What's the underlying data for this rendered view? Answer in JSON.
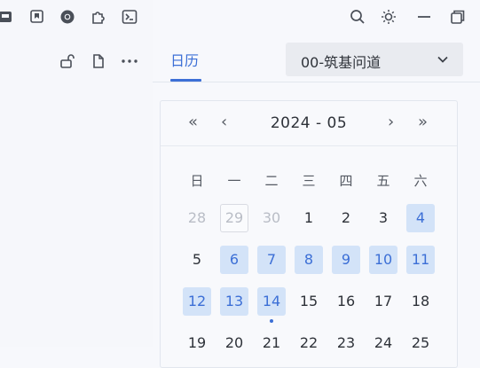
{
  "left_toolbar": {
    "icons": [
      "inbox-icon",
      "bookmark-icon",
      "chrome-icon",
      "puzzle-icon",
      "terminal-icon"
    ],
    "row2_icons": [
      "unlock-icon",
      "file-icon",
      "more-icon"
    ]
  },
  "window_controls": [
    "search-icon",
    "theme-icon",
    "minimize-icon",
    "restore-icon"
  ],
  "panel": {
    "tab_label": "日历",
    "select_value": "00-筑基问道"
  },
  "calendar": {
    "month_label": "2024 - 05",
    "nav": {
      "prev_year": "«",
      "prev_month": "‹",
      "next_month": "›",
      "next_year": "»"
    },
    "weekdays": [
      "日",
      "一",
      "二",
      "三",
      "四",
      "五",
      "六"
    ],
    "weeks": [
      [
        {
          "d": "28",
          "other": true
        },
        {
          "d": "29",
          "other": true,
          "today": true
        },
        {
          "d": "30",
          "other": true
        },
        {
          "d": "1"
        },
        {
          "d": "2"
        },
        {
          "d": "3"
        },
        {
          "d": "4",
          "marked": true
        }
      ],
      [
        {
          "d": "5"
        },
        {
          "d": "6",
          "marked": true
        },
        {
          "d": "7",
          "marked": true
        },
        {
          "d": "8",
          "marked": true
        },
        {
          "d": "9",
          "marked": true
        },
        {
          "d": "10",
          "marked": true
        },
        {
          "d": "11",
          "marked": true
        }
      ],
      [
        {
          "d": "12",
          "marked": true
        },
        {
          "d": "13",
          "marked": true
        },
        {
          "d": "14",
          "marked": true,
          "dot": true
        },
        {
          "d": "15"
        },
        {
          "d": "16"
        },
        {
          "d": "17"
        },
        {
          "d": "18"
        }
      ],
      [
        {
          "d": "19"
        },
        {
          "d": "20"
        },
        {
          "d": "21"
        },
        {
          "d": "22"
        },
        {
          "d": "23"
        },
        {
          "d": "24"
        },
        {
          "d": "25"
        }
      ]
    ]
  },
  "colors": {
    "accent": "#3c6fd6",
    "marked_bg": "#d3e3f8",
    "muted_text": "#b9bdc6"
  }
}
